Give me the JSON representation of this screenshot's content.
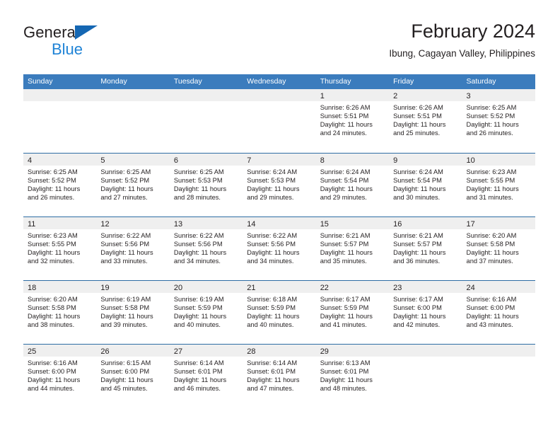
{
  "brand": {
    "line1": "General",
    "line2": "Blue",
    "flag_color": "#1567b3",
    "blue_text_color": "#1f83d6"
  },
  "header": {
    "title": "February 2024",
    "subtitle": "Ibung, Cagayan Valley, Philippines"
  },
  "theme": {
    "header_blue": "#3b7cbd",
    "row_divider": "#2e6da4",
    "day_band_gray": "#efefef",
    "text": "#231f20"
  },
  "calendar": {
    "weekdays": [
      "Sunday",
      "Monday",
      "Tuesday",
      "Wednesday",
      "Thursday",
      "Friday",
      "Saturday"
    ],
    "weeks": [
      [
        {
          "day": "",
          "empty": true
        },
        {
          "day": "",
          "empty": true
        },
        {
          "day": "",
          "empty": true
        },
        {
          "day": "",
          "empty": true
        },
        {
          "day": "1",
          "sunrise": "Sunrise: 6:26 AM",
          "sunset": "Sunset: 5:51 PM",
          "daylight1": "Daylight: 11 hours",
          "daylight2": "and 24 minutes."
        },
        {
          "day": "2",
          "sunrise": "Sunrise: 6:26 AM",
          "sunset": "Sunset: 5:51 PM",
          "daylight1": "Daylight: 11 hours",
          "daylight2": "and 25 minutes."
        },
        {
          "day": "3",
          "sunrise": "Sunrise: 6:25 AM",
          "sunset": "Sunset: 5:52 PM",
          "daylight1": "Daylight: 11 hours",
          "daylight2": "and 26 minutes."
        }
      ],
      [
        {
          "day": "4",
          "sunrise": "Sunrise: 6:25 AM",
          "sunset": "Sunset: 5:52 PM",
          "daylight1": "Daylight: 11 hours",
          "daylight2": "and 26 minutes."
        },
        {
          "day": "5",
          "sunrise": "Sunrise: 6:25 AM",
          "sunset": "Sunset: 5:52 PM",
          "daylight1": "Daylight: 11 hours",
          "daylight2": "and 27 minutes."
        },
        {
          "day": "6",
          "sunrise": "Sunrise: 6:25 AM",
          "sunset": "Sunset: 5:53 PM",
          "daylight1": "Daylight: 11 hours",
          "daylight2": "and 28 minutes."
        },
        {
          "day": "7",
          "sunrise": "Sunrise: 6:24 AM",
          "sunset": "Sunset: 5:53 PM",
          "daylight1": "Daylight: 11 hours",
          "daylight2": "and 29 minutes."
        },
        {
          "day": "8",
          "sunrise": "Sunrise: 6:24 AM",
          "sunset": "Sunset: 5:54 PM",
          "daylight1": "Daylight: 11 hours",
          "daylight2": "and 29 minutes."
        },
        {
          "day": "9",
          "sunrise": "Sunrise: 6:24 AM",
          "sunset": "Sunset: 5:54 PM",
          "daylight1": "Daylight: 11 hours",
          "daylight2": "and 30 minutes."
        },
        {
          "day": "10",
          "sunrise": "Sunrise: 6:23 AM",
          "sunset": "Sunset: 5:55 PM",
          "daylight1": "Daylight: 11 hours",
          "daylight2": "and 31 minutes."
        }
      ],
      [
        {
          "day": "11",
          "sunrise": "Sunrise: 6:23 AM",
          "sunset": "Sunset: 5:55 PM",
          "daylight1": "Daylight: 11 hours",
          "daylight2": "and 32 minutes."
        },
        {
          "day": "12",
          "sunrise": "Sunrise: 6:22 AM",
          "sunset": "Sunset: 5:56 PM",
          "daylight1": "Daylight: 11 hours",
          "daylight2": "and 33 minutes."
        },
        {
          "day": "13",
          "sunrise": "Sunrise: 6:22 AM",
          "sunset": "Sunset: 5:56 PM",
          "daylight1": "Daylight: 11 hours",
          "daylight2": "and 34 minutes."
        },
        {
          "day": "14",
          "sunrise": "Sunrise: 6:22 AM",
          "sunset": "Sunset: 5:56 PM",
          "daylight1": "Daylight: 11 hours",
          "daylight2": "and 34 minutes."
        },
        {
          "day": "15",
          "sunrise": "Sunrise: 6:21 AM",
          "sunset": "Sunset: 5:57 PM",
          "daylight1": "Daylight: 11 hours",
          "daylight2": "and 35 minutes."
        },
        {
          "day": "16",
          "sunrise": "Sunrise: 6:21 AM",
          "sunset": "Sunset: 5:57 PM",
          "daylight1": "Daylight: 11 hours",
          "daylight2": "and 36 minutes."
        },
        {
          "day": "17",
          "sunrise": "Sunrise: 6:20 AM",
          "sunset": "Sunset: 5:58 PM",
          "daylight1": "Daylight: 11 hours",
          "daylight2": "and 37 minutes."
        }
      ],
      [
        {
          "day": "18",
          "sunrise": "Sunrise: 6:20 AM",
          "sunset": "Sunset: 5:58 PM",
          "daylight1": "Daylight: 11 hours",
          "daylight2": "and 38 minutes."
        },
        {
          "day": "19",
          "sunrise": "Sunrise: 6:19 AM",
          "sunset": "Sunset: 5:58 PM",
          "daylight1": "Daylight: 11 hours",
          "daylight2": "and 39 minutes."
        },
        {
          "day": "20",
          "sunrise": "Sunrise: 6:19 AM",
          "sunset": "Sunset: 5:59 PM",
          "daylight1": "Daylight: 11 hours",
          "daylight2": "and 40 minutes."
        },
        {
          "day": "21",
          "sunrise": "Sunrise: 6:18 AM",
          "sunset": "Sunset: 5:59 PM",
          "daylight1": "Daylight: 11 hours",
          "daylight2": "and 40 minutes."
        },
        {
          "day": "22",
          "sunrise": "Sunrise: 6:17 AM",
          "sunset": "Sunset: 5:59 PM",
          "daylight1": "Daylight: 11 hours",
          "daylight2": "and 41 minutes."
        },
        {
          "day": "23",
          "sunrise": "Sunrise: 6:17 AM",
          "sunset": "Sunset: 6:00 PM",
          "daylight1": "Daylight: 11 hours",
          "daylight2": "and 42 minutes."
        },
        {
          "day": "24",
          "sunrise": "Sunrise: 6:16 AM",
          "sunset": "Sunset: 6:00 PM",
          "daylight1": "Daylight: 11 hours",
          "daylight2": "and 43 minutes."
        }
      ],
      [
        {
          "day": "25",
          "sunrise": "Sunrise: 6:16 AM",
          "sunset": "Sunset: 6:00 PM",
          "daylight1": "Daylight: 11 hours",
          "daylight2": "and 44 minutes."
        },
        {
          "day": "26",
          "sunrise": "Sunrise: 6:15 AM",
          "sunset": "Sunset: 6:00 PM",
          "daylight1": "Daylight: 11 hours",
          "daylight2": "and 45 minutes."
        },
        {
          "day": "27",
          "sunrise": "Sunrise: 6:14 AM",
          "sunset": "Sunset: 6:01 PM",
          "daylight1": "Daylight: 11 hours",
          "daylight2": "and 46 minutes."
        },
        {
          "day": "28",
          "sunrise": "Sunrise: 6:14 AM",
          "sunset": "Sunset: 6:01 PM",
          "daylight1": "Daylight: 11 hours",
          "daylight2": "and 47 minutes."
        },
        {
          "day": "29",
          "sunrise": "Sunrise: 6:13 AM",
          "sunset": "Sunset: 6:01 PM",
          "daylight1": "Daylight: 11 hours",
          "daylight2": "and 48 minutes."
        },
        {
          "day": "",
          "empty": true
        },
        {
          "day": "",
          "empty": true
        }
      ]
    ]
  }
}
